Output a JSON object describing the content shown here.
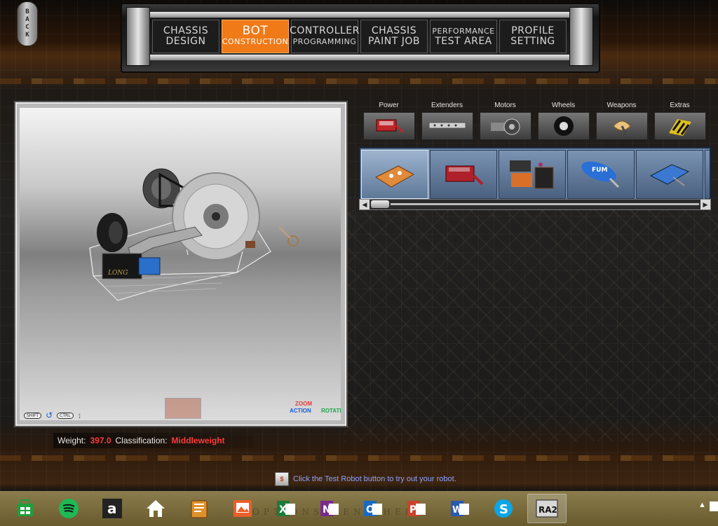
{
  "nav": {
    "back_label": "BACK",
    "tabs": [
      {
        "line1": "CHASSIS",
        "line2": "DESIGN",
        "active": false
      },
      {
        "line1": "BOT",
        "line2": "CONSTRUCTION",
        "active": true
      },
      {
        "line1": "CONTROLLER",
        "line2": "PROGRAMMING",
        "active": false
      },
      {
        "line1": "CHASSIS",
        "line2": "PAINT JOB",
        "active": false
      },
      {
        "line1": "PERFORMANCE",
        "line2": "TEST AREA",
        "active": false
      },
      {
        "line1": "PROFILE",
        "line2": "SETTING",
        "active": false
      }
    ]
  },
  "view": {
    "controls": {
      "shift": "SHIFT",
      "ctrl": "CTRL"
    },
    "zoom_label": "ZOOM",
    "action_label": "ACTION",
    "rotate_label": "ROTATE",
    "chassis_text": "LONG"
  },
  "status": {
    "weight_label": "Weight:",
    "weight_value": "397.0",
    "class_label": "Classification:",
    "class_value": "Middleweight"
  },
  "parts": {
    "categories": [
      {
        "label": "Power",
        "icon": "battery-icon"
      },
      {
        "label": "Extenders",
        "icon": "extender-bar-icon"
      },
      {
        "label": "Motors",
        "icon": "motor-icon"
      },
      {
        "label": "Wheels",
        "icon": "wheel-icon"
      },
      {
        "label": "Weapons",
        "icon": "weapon-icon"
      },
      {
        "label": "Extras",
        "icon": "extras-icon"
      }
    ],
    "items": [
      {
        "icon": "orange-battery-icon",
        "selected": true
      },
      {
        "icon": "red-battery-icon",
        "selected": false
      },
      {
        "icon": "battery-pack-icon",
        "selected": false
      },
      {
        "icon": "blue-cylinder-battery-icon",
        "selected": false,
        "text": "FUM"
      },
      {
        "icon": "blue-battery-icon",
        "selected": false
      }
    ]
  },
  "hint": {
    "icon_text": "$",
    "text": "Click the Test Robot button to try out your robot."
  },
  "taskbar": {
    "items": [
      {
        "name": "store",
        "label": "Store"
      },
      {
        "name": "spotify",
        "label": "Spotify"
      },
      {
        "name": "amazon",
        "label": "a"
      },
      {
        "name": "home",
        "label": "Home"
      },
      {
        "name": "files",
        "label": "Files"
      },
      {
        "name": "photos",
        "label": "Photos"
      },
      {
        "name": "excel",
        "label": "X"
      },
      {
        "name": "onenote",
        "label": "N"
      },
      {
        "name": "outlook",
        "label": "O"
      },
      {
        "name": "powerpoint",
        "label": "P"
      },
      {
        "name": "word",
        "label": "W"
      },
      {
        "name": "skype",
        "label": "S"
      },
      {
        "name": "ra2",
        "label": "RA2",
        "active": true
      }
    ],
    "ghost_text": "OPTIONS MENU HELP",
    "tray": "▲"
  },
  "colors": {
    "accent": "#f07a18",
    "status_value": "#ff3b3b",
    "hint_text": "#8ea0ff",
    "taskbar": "#7a6a34"
  }
}
